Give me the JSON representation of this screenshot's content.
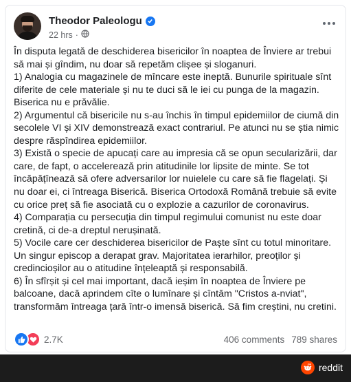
{
  "post": {
    "author": "Theodor Paleologu",
    "time": "22 hrs",
    "privacy_icon": "globe-icon",
    "lines": [
      "În disputa legată de deschiderea bisericilor în noaptea de Înviere ar trebui",
      "să mai și gîndim, nu doar să repetăm clișee și sloganuri.",
      "1) Analogia cu magazinele de mîncare este ineptă. Bunurile spirituale sînt",
      "diferite de cele materiale și nu te duci să le iei cu punga de la magazin.",
      "Biserica nu e prăvălie.",
      "2) Argumentul că bisericile nu s-au închis în timpul epidemiilor de ciumă din",
      "secolele VI și XIV demonstrează exact contrariul. Pe atunci nu se știa nimic",
      "despre răspîndirea epidemiilor.",
      "3) Există o specie de apucați care au impresia că se opun secularizării, dar",
      "care, de fapt, o accelerează prin atitudinile lor lipsite de minte. Se tot",
      "încăpățînează să ofere adversarilor lor nuielele cu care să fie flagelați. Și",
      "nu doar ei, ci întreaga Biserică. Biserica Ortodoxă Română trebuie să evite",
      "cu orice preț să fie asociată cu o explozie a cazurilor de coronavirus.",
      "4) Comparația cu persecuția din timpul regimului comunist nu este doar",
      "cretină, ci de-a dreptul nerușinată.",
      "5) Vocile care cer deschiderea bisericilor de Paște sînt cu totul minoritare.",
      "Un singur episcop a derapat grav. Majoritatea ierarhilor, preoților și",
      "credincioșilor au o atitudine înțeleaptă și responsabilă.",
      "6) În sfîrșit și cel mai important, dacă ieșim în noaptea de Înviere pe",
      "balcoane, dacă aprindem cîte o lumînare și cîntăm \"Cristos a-nviat\",",
      "transformăm întreaga țară într-o imensă biserică. Să fim creștini, nu cretini."
    ],
    "reactions": "2.7K",
    "comments": "406 comments",
    "shares": "789 shares"
  },
  "watermark": {
    "label": "reddit"
  },
  "colors": {
    "accent": "#1877f2",
    "love": "#f33e58",
    "reddit": "#ff4500"
  }
}
